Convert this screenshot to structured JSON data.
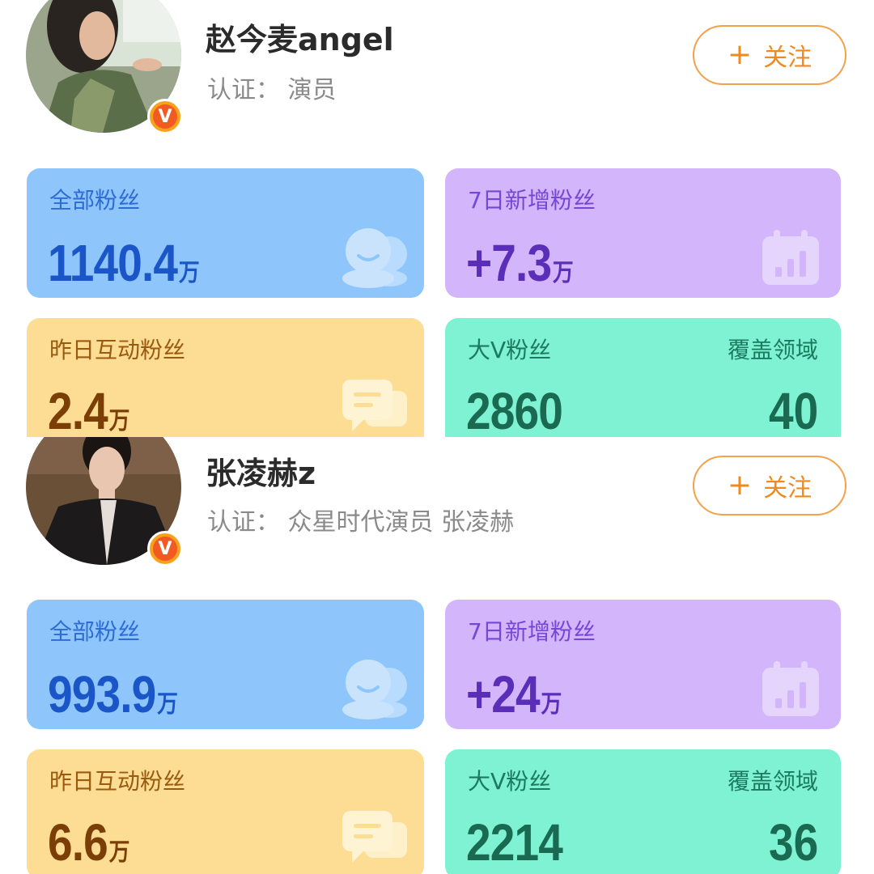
{
  "profiles": [
    {
      "name": "赵今麦angel",
      "certification": "认证：  演员",
      "verified_badge": "V",
      "follow_button": {
        "icon": "plus-icon",
        "label": "关注"
      },
      "stats": {
        "all_fans": {
          "label": "全部粉丝",
          "value": "1140.4",
          "unit": "万",
          "icon": "fans-icon"
        },
        "new_fans_7d": {
          "label": "7日新增粉丝",
          "value": "+7.3",
          "unit": "万",
          "icon": "calendar-chart-icon"
        },
        "interactive_fans_yesterday": {
          "label": "昨日互动粉丝",
          "value": "2.4",
          "unit": "万",
          "icon": "chat-icon"
        },
        "big_v_fans": {
          "label": "大V粉丝",
          "value": "2860",
          "coverage_label": "覆盖领域",
          "coverage_value": "40"
        }
      }
    },
    {
      "name": "张凌赫z",
      "certification": "认证：  众星时代演员 张凌赫",
      "verified_badge": "V",
      "follow_button": {
        "icon": "plus-icon",
        "label": "关注"
      },
      "stats": {
        "all_fans": {
          "label": "全部粉丝",
          "value": "993.9",
          "unit": "万",
          "icon": "fans-icon"
        },
        "new_fans_7d": {
          "label": "7日新增粉丝",
          "value": "+24",
          "unit": "万",
          "icon": "calendar-chart-icon"
        },
        "interactive_fans_yesterday": {
          "label": "昨日互动粉丝",
          "value": "6.6",
          "unit": "万",
          "icon": "chat-icon"
        },
        "big_v_fans": {
          "label": "大V粉丝",
          "value": "2214",
          "coverage_label": "覆盖领域",
          "coverage_value": "36"
        }
      }
    }
  ],
  "colors": {
    "blue_card": "#8ec6fb",
    "purple_card": "#d3b5fb",
    "yellow_card": "#fddd94",
    "green_card": "#7ef2d3",
    "follow_accent": "#f08a1f",
    "verified_badge": "#f7a21b"
  }
}
